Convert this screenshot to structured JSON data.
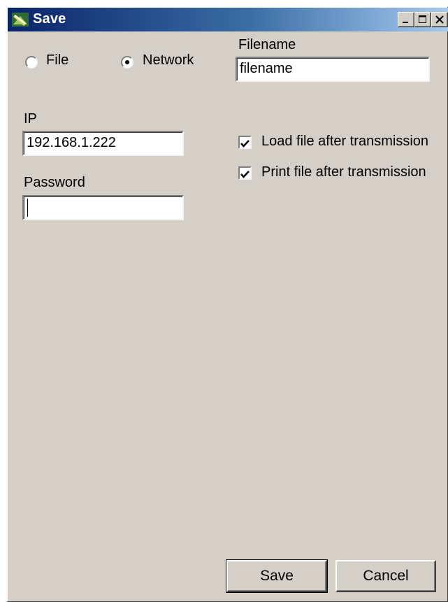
{
  "window": {
    "title": "Save"
  },
  "mode": {
    "options": [
      {
        "label": "File",
        "selected": false
      },
      {
        "label": "Network",
        "selected": true
      }
    ]
  },
  "filename": {
    "label": "Filename",
    "value": "filename"
  },
  "ip": {
    "label": "IP",
    "value": "192.168.1.222"
  },
  "password": {
    "label": "Password",
    "value": ""
  },
  "options": {
    "load_label": "Load file after transmission",
    "load_checked": true,
    "print_label": "Print file after transmission",
    "print_checked": true
  },
  "buttons": {
    "save": "Save",
    "cancel": "Cancel"
  },
  "colors": {
    "face": "#d4d0c8",
    "title_active_start": "#0a246a",
    "title_active_end": "#a6caf0"
  }
}
